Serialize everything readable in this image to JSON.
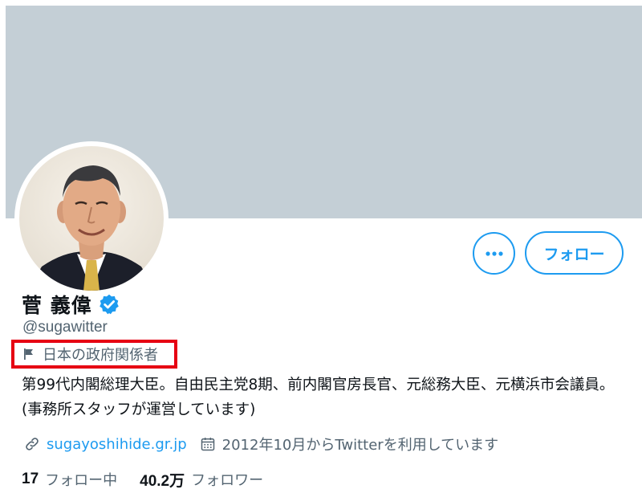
{
  "profile": {
    "name": "菅 義偉",
    "handle": "@sugawitter",
    "label": "日本の政府関係者",
    "bio": "第99代内閣総理大臣。自由民主党8期、前内閣官房長官、元総務大臣、元横浜市会議員。 (事務所スタッフが運営しています)",
    "website": "sugayoshihide.gr.jp",
    "joined": "2012年10月からTwitterを利用しています"
  },
  "actions": {
    "more_label": "•••",
    "follow_label": "フォロー"
  },
  "stats": {
    "following_count": "17",
    "following_label": "フォロー中",
    "followers_count": "40.2万",
    "followers_label": "フォロワー"
  },
  "icons": {
    "verified": "verified-badge-icon",
    "label": "flag-icon",
    "website": "link-icon",
    "joined": "calendar-icon"
  },
  "colors": {
    "accent": "#1d9bf0",
    "banner": "#c4cfd6",
    "highlight_box": "#e60012",
    "secondary_text": "#536471"
  }
}
